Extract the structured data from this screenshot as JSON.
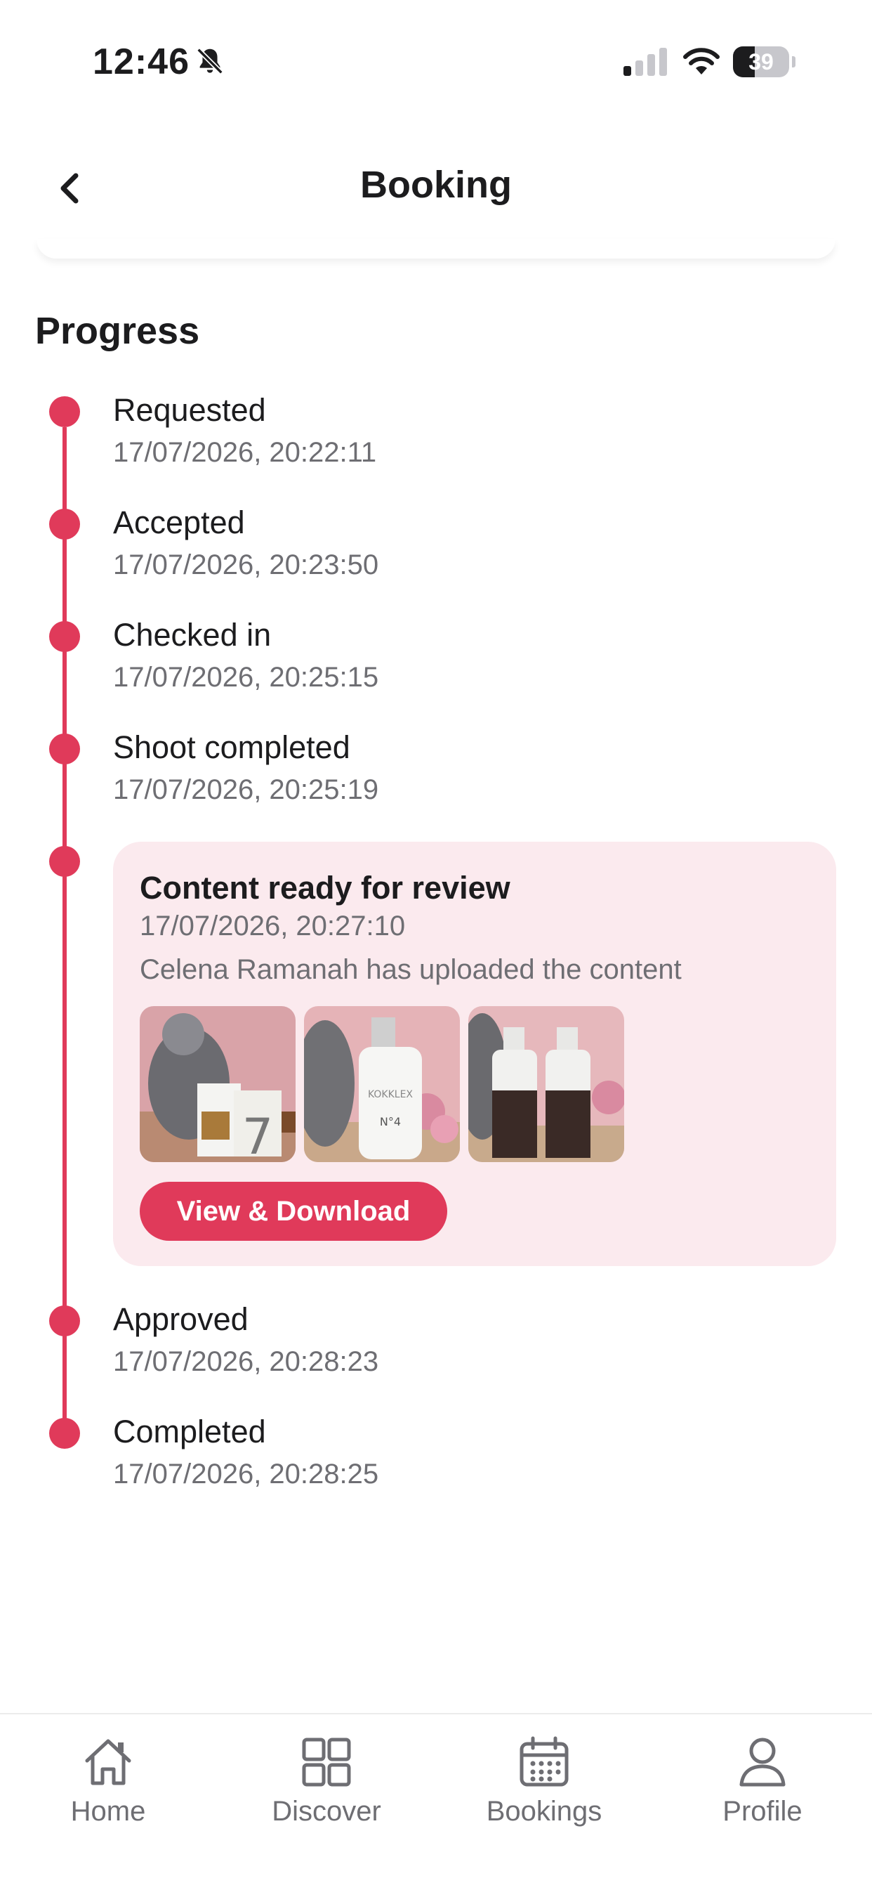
{
  "status_bar": {
    "time": "12:46",
    "battery": "39"
  },
  "header": {
    "title": "Booking"
  },
  "progress": {
    "title": "Progress",
    "steps": [
      {
        "label": "Requested",
        "time": "17/07/2026, 20:22:11"
      },
      {
        "label": "Accepted",
        "time": "17/07/2026, 20:23:50"
      },
      {
        "label": "Checked in",
        "time": "17/07/2026, 20:25:15"
      },
      {
        "label": "Shoot completed",
        "time": "17/07/2026, 20:25:19"
      },
      {
        "label": "Content ready for review",
        "time": "17/07/2026, 20:27:10",
        "description": "Celena Ramanah has uploaded the content",
        "button": "View & Download"
      },
      {
        "label": "Approved",
        "time": "17/07/2026, 20:28:23"
      },
      {
        "label": "Completed",
        "time": "17/07/2026, 20:28:25"
      }
    ]
  },
  "tabs": [
    {
      "label": "Home",
      "icon": "home-icon"
    },
    {
      "label": "Discover",
      "icon": "grid-icon"
    },
    {
      "label": "Bookings",
      "icon": "calendar-icon"
    },
    {
      "label": "Profile",
      "icon": "person-icon"
    }
  ],
  "colors": {
    "accent": "#e03a5a",
    "card_bg": "#fbeaee",
    "muted_text": "#6e6e73"
  }
}
